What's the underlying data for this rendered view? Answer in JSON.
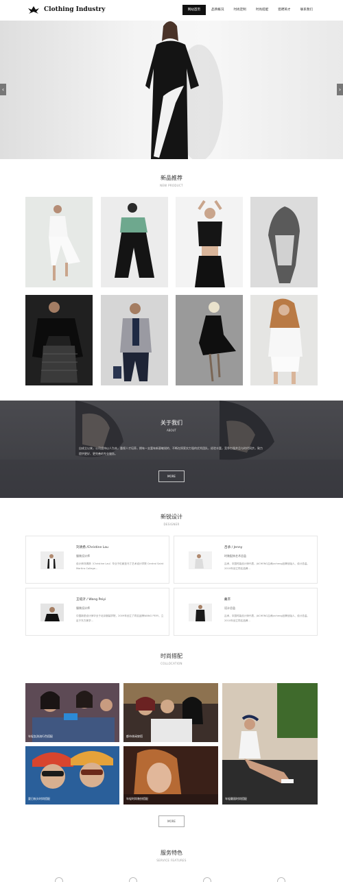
{
  "header": {
    "brand": "Clothing Industry",
    "nav": [
      "网站首页",
      "品牌概况",
      "时尚定制",
      "时尚搭配",
      "猎聘英才",
      "联系我们"
    ]
  },
  "hero": {
    "prev": "‹",
    "next": "›"
  },
  "new_products": {
    "title": "新品推荐",
    "subtitle": "NEW PRODUCT"
  },
  "about": {
    "title": "关于我们",
    "subtitle": "ABOUT",
    "text": "自成立以来，公司坚持以人为本，重视人才培养，拥有一支富有新意敏锐的、不断在探索实力强的优秀团队，经验丰富，竞争力强并且与时代同步。致力提供更好、更完善的专业服务。",
    "more": "MORE"
  },
  "designers": {
    "title": "新锐设计",
    "subtitle": "DESIGNER",
    "items": [
      {
        "name": "刘清扬 /Christine Lau",
        "role": "服装设计师",
        "desc": "设计师刘清扬（Christine Lau）毕业于伦敦圣马丁艺术设计学院 Central Saint Martins College..."
      },
      {
        "name": "吕承 / Jenny",
        "role": "时装配饰艺术总监",
        "desc": "吕承，中国时装设计师代表，JACHENG吕承Jacheng品牌创始人、设计总监。2010年创立同名品牌..."
      },
      {
        "name": "王培沂 / Wang Peiyi",
        "role": "服装设计师",
        "desc": "中国新锐设计师毕业于北京服装学院，2009年创立了同名品牌WANG PEIYI，立足于东方美学..."
      },
      {
        "name": "戴丰",
        "role": "设计总监",
        "desc": "吕承，中国时装设计师代表，JACHENG吕承Jacheng品牌创始人、设计总监。2010年创立同名品牌..."
      }
    ]
  },
  "collocation": {
    "title": "时尚搭配",
    "subtitle": "COLLOCATION",
    "captions": [
      "年轻女孩流行色搭配",
      "都市休闲穿搭",
      "年轻靓丽时尚搭配",
      "夏日街头时尚搭配",
      "年轻时尚装扮搭配"
    ],
    "more": "MORE"
  },
  "features": {
    "title": "服务特色",
    "subtitle": "SERVICE FEATURES"
  },
  "colors": {
    "dark": "#111111",
    "about_bg": "#3f4045",
    "border": "#e6e6e6"
  }
}
